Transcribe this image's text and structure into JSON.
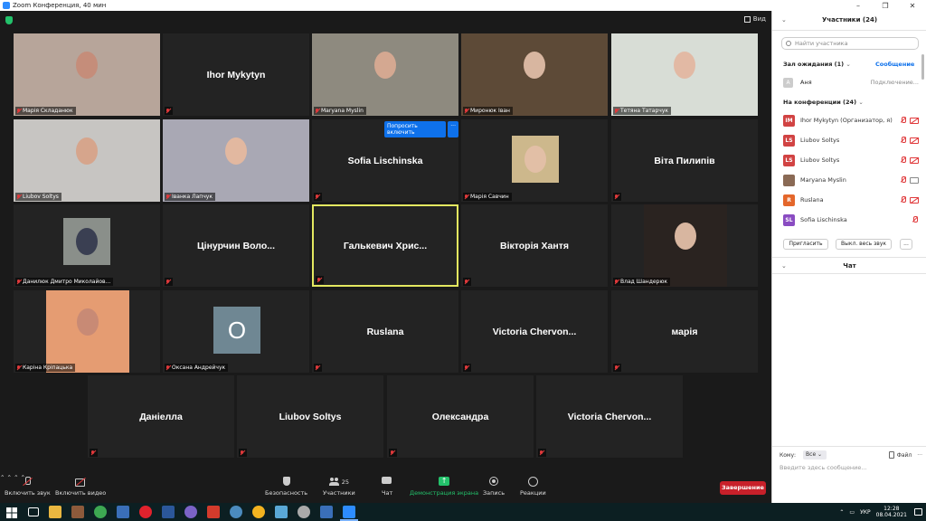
{
  "window": {
    "title": "Zoom Конференция, 40 мин",
    "minimize": "–",
    "maximize": "❐",
    "close": "✕"
  },
  "view_label": "Вид",
  "tiles": [
    {
      "label": "Марія Складанюк",
      "big": ""
    },
    {
      "label": "",
      "big": "Ihor Mykytyn"
    },
    {
      "label": "Maryana Myslin",
      "big": ""
    },
    {
      "label": "Миронюк Іван",
      "big": ""
    },
    {
      "label": "Тетяна Татарчук",
      "big": ""
    },
    {
      "label": "Liubov Soltys",
      "big": ""
    },
    {
      "label": "Іванка Лапчук",
      "big": ""
    },
    {
      "label": "",
      "big": "Sofia Lischinska"
    },
    {
      "label": "Марія Савчин",
      "big": ""
    },
    {
      "label": "",
      "big": "Віта Пилипів"
    },
    {
      "label": "Данилюк Дмитро Миколайов...",
      "big": ""
    },
    {
      "label": "",
      "big": "Цінурчин  Воло..."
    },
    {
      "label": "",
      "big": "Галькевич  Хрис..."
    },
    {
      "label": "",
      "big": "Вікторія Хантя"
    },
    {
      "label": "Влад Шандерюк",
      "big": ""
    },
    {
      "label": "Каріна Кріпацька",
      "big": ""
    },
    {
      "label": "Оксана Андрейчук",
      "big": "",
      "avatar": "O"
    },
    {
      "label": "",
      "big": "Ruslana"
    },
    {
      "label": "",
      "big": "Victoria  Chervon..."
    },
    {
      "label": "",
      "big": "марія"
    },
    {
      "label": "",
      "big": "Даніелла"
    },
    {
      "label": "",
      "big": "Liubov Soltys"
    },
    {
      "label": "",
      "big": "Олександра"
    },
    {
      "label": "",
      "big": "Victoria  Chervon..."
    }
  ],
  "ask_unmute": {
    "label": "Попросить включить",
    "more": "···"
  },
  "toolbar": {
    "mute": "Включить звук",
    "video": "Включить видео",
    "security": "Безопасность",
    "participants": "Участники",
    "participants_count": "25",
    "chat": "Чат",
    "share": "Демонстрация экрана",
    "record": "Запись",
    "reactions": "Реакции",
    "end": "Завершение"
  },
  "panel": {
    "title": "Участники  (24)",
    "search_placeholder": "Найти участника",
    "waiting_title": "Зал ожидания  (1)",
    "waiting_message": "Сообщение",
    "waiting": {
      "initial": "A",
      "name": "Аня",
      "action": "Подключение..."
    },
    "in_meeting_title": "На конференции (24)",
    "participants": [
      {
        "initials": "IM",
        "name": "Ihor Mykytyn (Организатор, я)",
        "color": "#d14343"
      },
      {
        "initials": "LS",
        "name": "Liubov Soltys",
        "color": "#d14343"
      },
      {
        "initials": "LS",
        "name": "Liubov Soltys",
        "color": "#d14343"
      },
      {
        "initials": "",
        "name": "Maryana Myslin",
        "color": "#8a6a55"
      },
      {
        "initials": "R",
        "name": "Ruslana",
        "color": "#e4672b"
      },
      {
        "initials": "SL",
        "name": "Sofia Lischinska",
        "color": "#8a4cc2"
      }
    ],
    "invite": "Пригласить",
    "mute_all": "Выкл. весь звук",
    "more": "...",
    "chat_title": "Чат",
    "to_label": "Кому:",
    "to_value": "Все",
    "file": "Файл",
    "more_dots": "···",
    "chat_placeholder": "Введите здесь сообщение..."
  },
  "taskbar": {
    "lang": "УКР",
    "time": "12:28",
    "date": "08.04.2021",
    "tray_arrow": "⌃"
  }
}
